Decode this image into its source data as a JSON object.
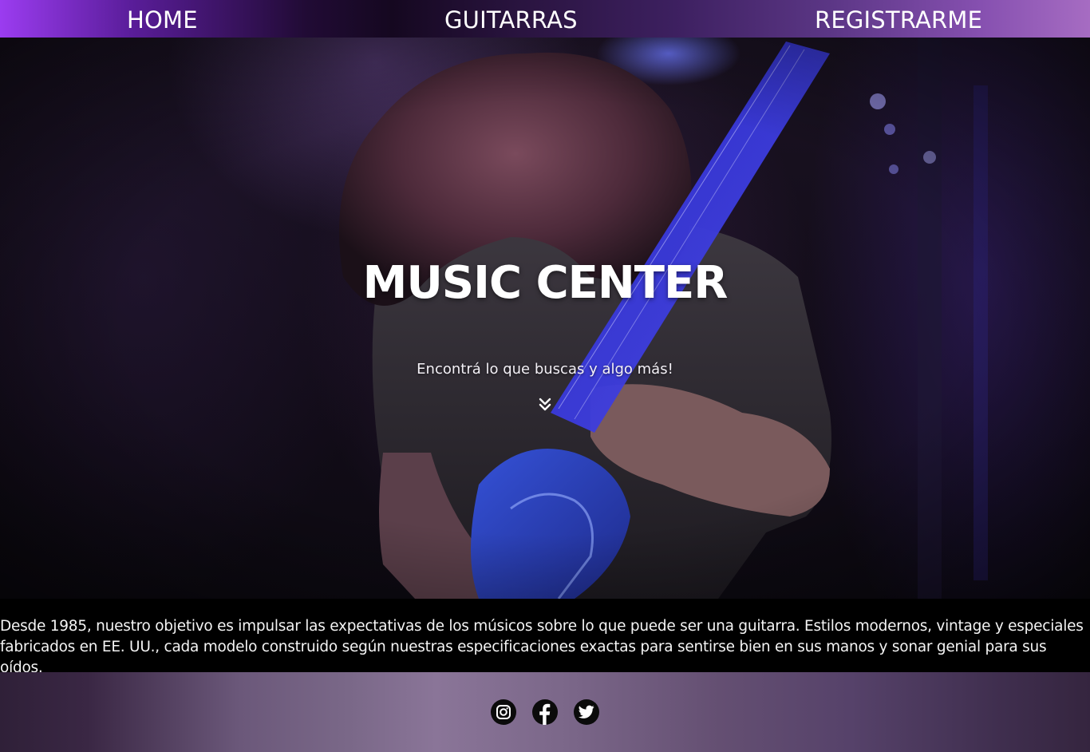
{
  "nav": {
    "items": [
      {
        "label": "HOME"
      },
      {
        "label": "GUITARRAS"
      },
      {
        "label": "REGISTRARME"
      }
    ]
  },
  "hero": {
    "title": "MUSIC CENTER",
    "subtitle": "Encontrá lo que buscas y algo más!",
    "scroll_icon": "double-chevron-down-icon"
  },
  "about": {
    "text": "Desde 1985, nuestro objetivo es impulsar las expectativas de los músicos sobre lo que puede ser una guitarra. Estilos modernos, vintage y especiales fabricados en EE. UU., cada modelo construido según nuestras especificaciones exactas para sentirse bien en sus manos y sonar genial para sus oídos."
  },
  "footer": {
    "social": [
      {
        "icon": "instagram-icon"
      },
      {
        "icon": "facebook-icon"
      },
      {
        "icon": "twitter-icon"
      }
    ]
  },
  "colors": {
    "nav_accent_left": "#9b3cf0",
    "nav_accent_right": "#a66cc2",
    "about_bg": "#000000",
    "footer_mid": "#8a7598"
  }
}
